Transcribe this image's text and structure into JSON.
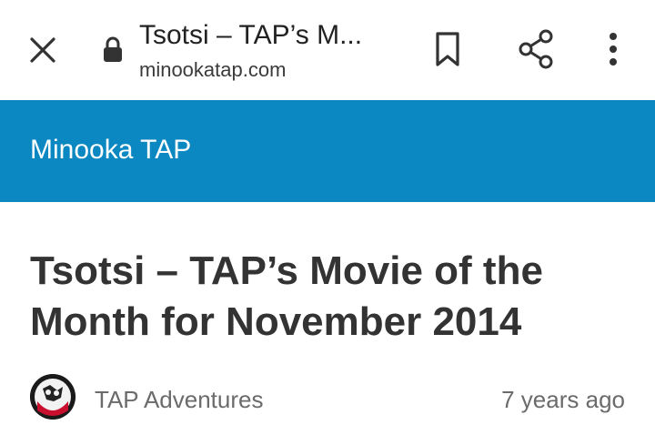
{
  "browser": {
    "page_title": "Tsotsi – TAP’s M...",
    "url": "minookatap.com",
    "icons": [
      "close-icon",
      "lock-icon",
      "bookmark-icon",
      "share-icon",
      "more-vert-icon"
    ]
  },
  "site": {
    "name": "Minooka TAP",
    "brand_color": "#0b87c2"
  },
  "article": {
    "title": "Tsotsi – TAP’s Movie of the Month for November 2014",
    "author": "TAP Adventures",
    "published": "7 years ago"
  }
}
